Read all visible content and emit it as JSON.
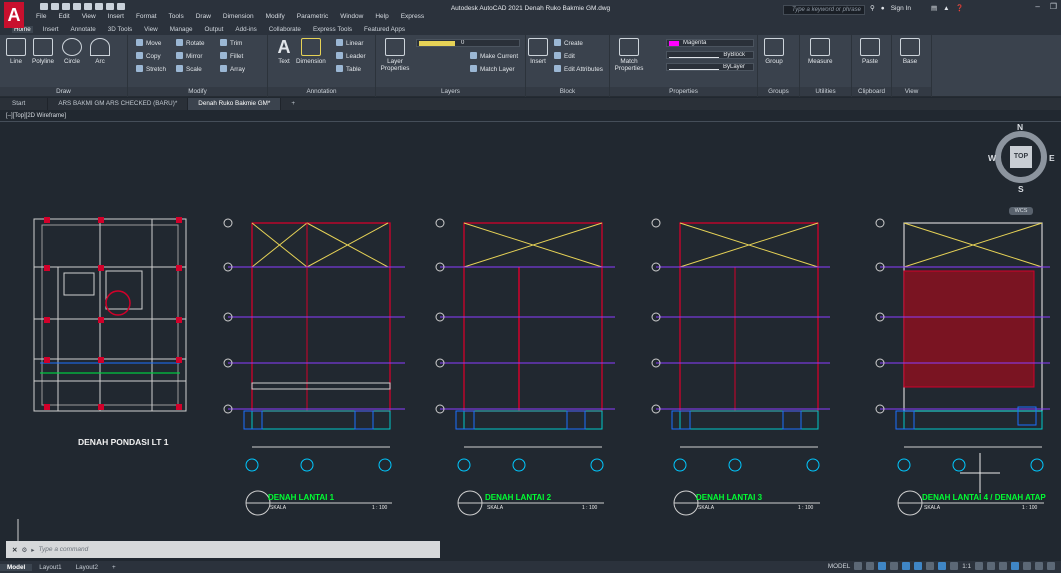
{
  "app": {
    "logo": "A",
    "window_title": "Autodesk AutoCAD 2021   Denah Ruko Bakmie GM.dwg",
    "search_placeholder": "Type a keyword or phrase",
    "sign_in": "Sign In",
    "menu": [
      "File",
      "Edit",
      "View",
      "Insert",
      "Format",
      "Tools",
      "Draw",
      "Dimension",
      "Modify",
      "Parametric",
      "Window",
      "Help",
      "Express"
    ]
  },
  "ribbon_tabs": [
    "Home",
    "Insert",
    "Annotate",
    "3D Tools",
    "View",
    "Manage",
    "Output",
    "Add-ins",
    "Collaborate",
    "Express Tools",
    "Featured Apps"
  ],
  "ribbon": {
    "draw": {
      "label": "Draw",
      "tools": [
        "Line",
        "Polyline",
        "Circle",
        "Arc"
      ]
    },
    "modify": {
      "label": "Modify",
      "tools": [
        "Move",
        "Rotate",
        "Trim",
        "Copy",
        "Mirror",
        "Fillet",
        "Stretch",
        "Scale",
        "Array"
      ]
    },
    "annotation": {
      "label": "Annotation",
      "tools": [
        "Text",
        "Dimension",
        "Linear",
        "Leader",
        "Table"
      ]
    },
    "layers": {
      "label": "Layers",
      "tools": [
        "Layer Properties",
        "Make Current",
        "Match Layer"
      ],
      "current_layer": "0"
    },
    "block": {
      "label": "Block",
      "tools": [
        "Insert",
        "Create",
        "Edit",
        "Edit Attributes"
      ]
    },
    "properties": {
      "label": "Properties",
      "match": "Match Properties",
      "color": "Magenta",
      "linetype": "ByBlock",
      "lineweight": "ByLayer",
      "color_hex": "#ff00ff"
    },
    "groups": {
      "label": "Groups",
      "tool": "Group"
    },
    "utilities": {
      "label": "Utilities",
      "tool": "Measure"
    },
    "clipboard": {
      "label": "Clipboard",
      "tool": "Paste"
    },
    "view": {
      "label": "View",
      "tool": "Base"
    }
  },
  "doc_tabs": [
    "Start",
    "ARS BAKMI GM ARS CHECKED (BARU)*",
    "Denah Ruko Bakmie GM*"
  ],
  "viewport": {
    "label": "[–][Top][2D Wireframe]",
    "viewcube": {
      "top": "TOP",
      "n": "N",
      "s": "S",
      "e": "E",
      "w": "W",
      "wcs": "WCS"
    },
    "drawings": {
      "foundation": "DENAH PONDASI LT 1",
      "plans": [
        {
          "title": "DENAH LANTAI 1",
          "scale_label": "SKALA",
          "scale": "1 : 100"
        },
        {
          "title": "DENAH LANTAI 2",
          "scale_label": "SKALA",
          "scale": "1 : 100"
        },
        {
          "title": "DENAH LANTAI 3",
          "scale_label": "SKALA",
          "scale": "1 : 100"
        },
        {
          "title": "DENAH LANTAI 4 / DENAH ATAP",
          "scale_label": "SKALA",
          "scale": "1 : 100"
        }
      ]
    }
  },
  "command": {
    "placeholder": "Type a command"
  },
  "layout_tabs": [
    "Model",
    "Layout1",
    "Layout2"
  ],
  "status": {
    "mode": "MODEL",
    "scale": "1:1"
  }
}
